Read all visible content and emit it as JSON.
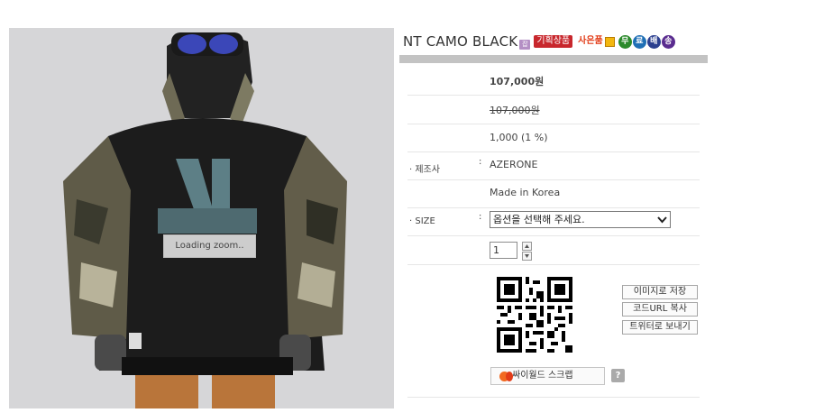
{
  "photo": {
    "loading_text": "Loading zoom.."
  },
  "product": {
    "title": "NT CAMO BLACK",
    "badges": {
      "new": "잡",
      "planned": "기획상품",
      "gift": "사은품",
      "free_shipping": [
        "무",
        "료",
        "배",
        "송"
      ]
    },
    "colors": {
      "price": "#1b7fb2",
      "planned_badge": "#c8272d",
      "gift_text": "#e23b17"
    }
  },
  "info": {
    "sale_price": "107,000원",
    "list_price": "107,000원",
    "points": "1,000 (1 %)",
    "manufacturer_label": "· 제조사",
    "manufacturer_colon": ":",
    "manufacturer": "AZERONE",
    "origin": "Made in Korea",
    "size_label": "· SIZE",
    "size_colon": ":",
    "size_select": "옵션을 선택해 주세요.",
    "quantity": "1"
  },
  "qr_actions": {
    "save_image": "이미지로 저장",
    "copy_url": "코드URL 복사",
    "send_twitter": "트위터로 보내기"
  },
  "scrap": {
    "label": "싸이월드 스크랩",
    "help": "?"
  }
}
